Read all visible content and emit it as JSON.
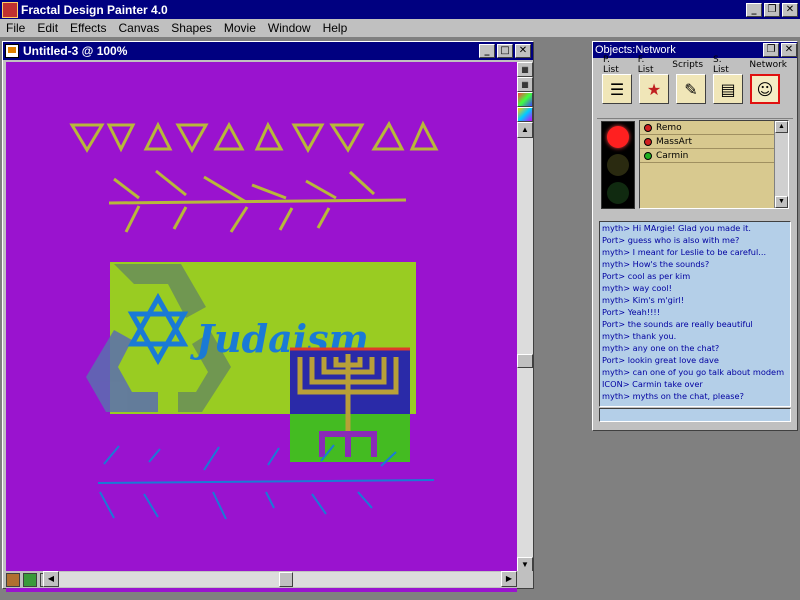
{
  "app": {
    "title": "Fractal Design Painter 4.0"
  },
  "menu": [
    "File",
    "Edit",
    "Effects",
    "Canvas",
    "Shapes",
    "Movie",
    "Window",
    "Help"
  ],
  "document": {
    "title": "Untitled-3 @ 100%"
  },
  "canvas": {
    "background": "#9a13cf",
    "artwork_text": "Judaism"
  },
  "network_panel": {
    "title": "Objects:Network",
    "tabs": [
      "P. List",
      "F. List",
      "Scripts",
      "S. List",
      "Network"
    ],
    "active_tab": "Network",
    "users": [
      {
        "name": "Remo",
        "status_color": "#d02020"
      },
      {
        "name": "MassArt",
        "status_color": "#d02020"
      },
      {
        "name": "Carmin",
        "status_color": "#20b020"
      }
    ],
    "chat": [
      "myth> Hi MArgie!  Glad you made it.",
      "Port> guess who is also with me?",
      "myth> I meant for Leslie to be careful...",
      "myth> How's the sounds?",
      "Port> cool as per kim",
      "myth> way cool!",
      "myth> Kim's m'girl!",
      "Port> Yeah!!!!",
      "Port> the sounds are really beautiful",
      "myth> thank you.",
      "myth> any one on the chat?",
      "Port> lookin great love dave",
      "myth> can one of you go talk about modem",
      "ICON> Carmin take over",
      "myth> myths on the chat, please?"
    ]
  },
  "colors": {
    "titlebar": "#000080",
    "chrome": "#c0c0c0",
    "chat_bg": "#b4cfe8",
    "userlist_bg": "#d8c98f",
    "art_green": "#99cc22",
    "art_blue": "#1a7ad6"
  }
}
